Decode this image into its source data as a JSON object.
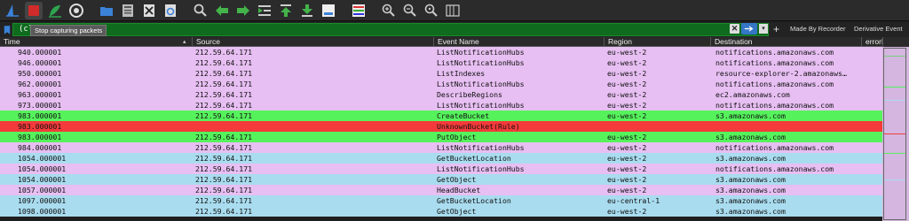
{
  "toolbar": {
    "buttons": [
      {
        "name": "start-capture-icon",
        "color": "#3b82d9"
      },
      {
        "name": "stop-capture-icon",
        "color": "#d22b2b"
      },
      {
        "name": "restart-capture-icon",
        "color": "#2ea44f"
      },
      {
        "name": "capture-options-icon",
        "color": "#cccccc"
      },
      {
        "name": "open-file-icon",
        "color": "#3b82d9"
      },
      {
        "name": "save-file-icon",
        "color": "#cccccc"
      },
      {
        "name": "close-file-icon",
        "color": "#cccccc"
      },
      {
        "name": "reload-file-icon",
        "color": "#3b82d9"
      },
      {
        "name": "find-packet-icon",
        "color": "#cccccc"
      },
      {
        "name": "go-back-icon",
        "color": "#43b34a"
      },
      {
        "name": "go-forward-icon",
        "color": "#43b34a"
      },
      {
        "name": "go-to-packet-icon",
        "color": "#43b34a"
      },
      {
        "name": "go-first-icon",
        "color": "#43b34a"
      },
      {
        "name": "go-last-icon",
        "color": "#43b34a"
      },
      {
        "name": "autoscroll-icon",
        "color": "#3b82d9"
      },
      {
        "name": "colorize-icon",
        "color": "#cccccc"
      },
      {
        "name": "zoom-in-icon",
        "color": "#cccccc"
      },
      {
        "name": "zoom-out-icon",
        "color": "#cccccc"
      },
      {
        "name": "zoom-reset-icon",
        "color": "#cccccc"
      },
      {
        "name": "resize-columns-icon",
        "color": "#cccccc"
      }
    ],
    "tooltip": "Stop capturing packets"
  },
  "filter": {
    "value": "(clou                    er == \"1\")",
    "clear_label": "✕",
    "made_by_recorder": "Made By Recorder",
    "derivative_event": "Derivative Event"
  },
  "columns": {
    "time": "Time",
    "source": "Source",
    "event_name": "Event Name",
    "region": "Region",
    "destination": "Destination",
    "error": "errorMessage"
  },
  "colors": {
    "purple": "#e7bff2",
    "green": "#56f25c",
    "red": "#f43a3a",
    "blue": "#a9dcef"
  },
  "rows": [
    {
      "time": "940.000001",
      "source": "212.59.64.171",
      "event": "ListNotificationHubs",
      "region": "eu-west-2",
      "destination": "notifications.amazonaws.com",
      "color": "purple"
    },
    {
      "time": "946.000001",
      "source": "212.59.64.171",
      "event": "ListNotificationHubs",
      "region": "eu-west-2",
      "destination": "notifications.amazonaws.com",
      "color": "purple"
    },
    {
      "time": "950.000001",
      "source": "212.59.64.171",
      "event": "ListIndexes",
      "region": "eu-west-2",
      "destination": "resource-explorer-2.amazonaws…",
      "color": "purple"
    },
    {
      "time": "962.000001",
      "source": "212.59.64.171",
      "event": "ListNotificationHubs",
      "region": "eu-west-2",
      "destination": "notifications.amazonaws.com",
      "color": "purple"
    },
    {
      "time": "963.000001",
      "source": "212.59.64.171",
      "event": "DescribeRegions",
      "region": "eu-west-2",
      "destination": "ec2.amazonaws.com",
      "color": "purple"
    },
    {
      "time": "973.000001",
      "source": "212.59.64.171",
      "event": "ListNotificationHubs",
      "region": "eu-west-2",
      "destination": "notifications.amazonaws.com",
      "color": "purple"
    },
    {
      "time": "983.000001",
      "source": "212.59.64.171",
      "event": "CreateBucket",
      "region": "eu-west-2",
      "destination": "s3.amazonaws.com",
      "color": "green"
    },
    {
      "time": "983.000001",
      "source": "",
      "event": "UnknownBucket(Rule)",
      "region": "",
      "destination": "",
      "color": "red"
    },
    {
      "time": "983.000001",
      "source": "212.59.64.171",
      "event": "PutObject",
      "region": "eu-west-2",
      "destination": "s3.amazonaws.com",
      "color": "green"
    },
    {
      "time": "984.000001",
      "source": "212.59.64.171",
      "event": "ListNotificationHubs",
      "region": "eu-west-2",
      "destination": "notifications.amazonaws.com",
      "color": "purple"
    },
    {
      "time": "1054.000001",
      "source": "212.59.64.171",
      "event": "GetBucketLocation",
      "region": "eu-west-2",
      "destination": "s3.amazonaws.com",
      "color": "blue"
    },
    {
      "time": "1054.000001",
      "source": "212.59.64.171",
      "event": "ListNotificationHubs",
      "region": "eu-west-2",
      "destination": "notifications.amazonaws.com",
      "color": "purple"
    },
    {
      "time": "1054.000001",
      "source": "212.59.64.171",
      "event": "GetObject",
      "region": "eu-west-2",
      "destination": "s3.amazonaws.com",
      "color": "blue"
    },
    {
      "time": "1057.000001",
      "source": "212.59.64.171",
      "event": "HeadBucket",
      "region": "eu-west-2",
      "destination": "s3.amazonaws.com",
      "color": "purple"
    },
    {
      "time": "1097.000001",
      "source": "212.59.64.171",
      "event": "GetBucketLocation",
      "region": "eu-central-1",
      "destination": "s3.amazonaws.com",
      "color": "blue"
    },
    {
      "time": "1098.000001",
      "source": "212.59.64.171",
      "event": "GetObject",
      "region": "eu-west-2",
      "destination": "s3.amazonaws.com",
      "color": "blue"
    }
  ]
}
